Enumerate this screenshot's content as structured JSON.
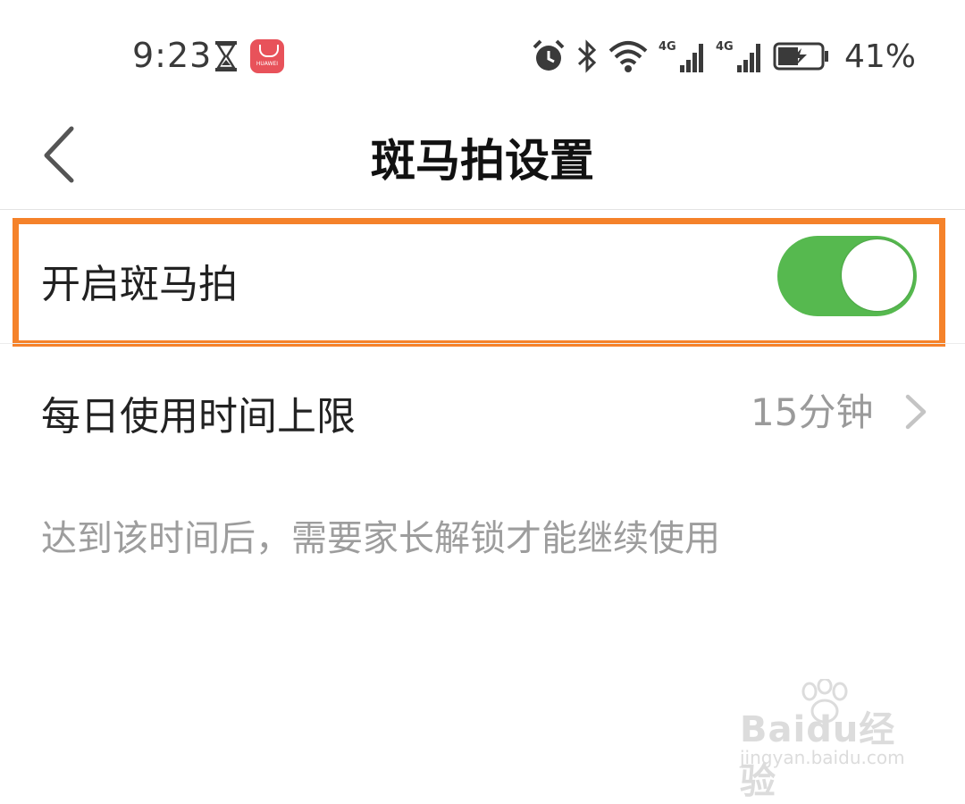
{
  "status_bar": {
    "time": "9:23",
    "app_icon_text": "HUAWEI",
    "battery_percent": "41%",
    "network_labels": [
      "4G",
      "4G"
    ]
  },
  "nav": {
    "title": "斑马拍设置",
    "back_icon": "chevron-left-icon"
  },
  "settings": {
    "enable_label": "开启斑马拍",
    "enable_on": true,
    "limit_label": "每日使用时间上限",
    "limit_value": "15分钟",
    "description": "达到该时间后，需要家长解锁才能继续使用"
  },
  "watermark": {
    "main": "Baidu经验",
    "sub": "jingyan.baidu.com"
  },
  "colors": {
    "switch_on": "#56b94f",
    "highlight": "#f5822a",
    "secondary_text": "#9d9d9d"
  }
}
